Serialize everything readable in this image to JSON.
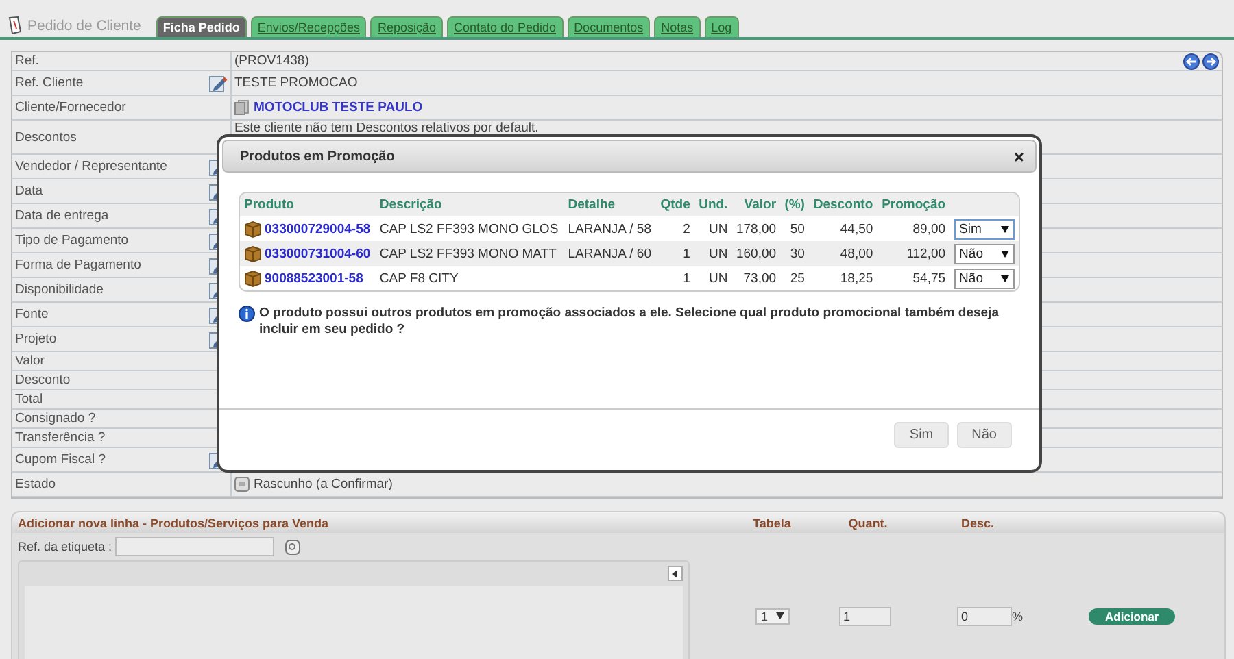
{
  "header": {
    "title": "Pedido de Cliente",
    "tabs": [
      {
        "label": "Ficha Pedido",
        "selected": true
      },
      {
        "label": "Envios/Recepções",
        "selected": false
      },
      {
        "label": "Reposição",
        "selected": false
      },
      {
        "label": "Contato do Pedido",
        "selected": false
      },
      {
        "label": "Documentos",
        "selected": false
      },
      {
        "label": "Notas",
        "selected": false
      },
      {
        "label": "Log",
        "selected": false
      }
    ]
  },
  "form": {
    "rows": [
      {
        "label": "Ref.",
        "kind": "text",
        "value": "(PROV1438)",
        "editable": false
      },
      {
        "label": "Ref. Cliente",
        "kind": "text",
        "value": "TESTE PROMOCAO",
        "editable": true
      },
      {
        "label": "Cliente/Fornecedor",
        "kind": "link",
        "value": "MOTOCLUB TESTE PAULO",
        "editable": false
      },
      {
        "label": "Descontos",
        "kind": "note",
        "value": "Este cliente não tem Descontos relativos por default.",
        "editable": false
      },
      {
        "label": "Vendedor / Representante",
        "kind": "text",
        "editable": true
      },
      {
        "label": "Data",
        "kind": "text",
        "editable": true
      },
      {
        "label": "Data de entrega",
        "kind": "text",
        "editable": true
      },
      {
        "label": "Tipo de Pagamento",
        "kind": "text",
        "editable": true
      },
      {
        "label": "Forma de Pagamento",
        "kind": "text",
        "editable": true
      },
      {
        "label": "Disponibilidade",
        "kind": "text",
        "editable": true
      },
      {
        "label": "Fonte",
        "kind": "text",
        "editable": true
      },
      {
        "label": "Projeto",
        "kind": "text",
        "editable": true
      },
      {
        "label": "Valor",
        "kind": "text",
        "editable": false
      },
      {
        "label": "Desconto",
        "kind": "text",
        "editable": false
      },
      {
        "label": "Total",
        "kind": "text",
        "editable": false
      },
      {
        "label": "Consignado ?",
        "kind": "text",
        "editable": false
      },
      {
        "label": "Transferência ?",
        "kind": "text",
        "editable": false
      },
      {
        "label": "Cupom Fiscal ?",
        "kind": "text",
        "editable": true
      },
      {
        "label": "Estado",
        "kind": "status",
        "value": "Rascunho (a Confirmar)",
        "editable": false
      }
    ]
  },
  "dialog": {
    "title": "Produtos em Promoção",
    "close": "×",
    "columns": [
      "Produto",
      "Descrição",
      "Detalhe",
      "Qtde",
      "Und.",
      "Valor",
      "(%)",
      "Desconto",
      "Promoção"
    ],
    "rows": [
      {
        "code": "033000729004-58",
        "description": "CAP LS2 FF393 MONO GLOS",
        "detail": "LARANJA / 58",
        "qty": "2",
        "unit": "UN",
        "price": "178,00",
        "percent": "50",
        "discount": "44,50",
        "promo": "89,00",
        "choice": "Sim",
        "focused": true
      },
      {
        "code": "033000731004-60",
        "description": "CAP LS2 FF393 MONO MATT",
        "detail": "LARANJA / 60",
        "qty": "1",
        "unit": "UN",
        "price": "160,00",
        "percent": "30",
        "discount": "48,00",
        "promo": "112,00",
        "choice": "Não",
        "focused": false
      },
      {
        "code": "90088523001-58",
        "description": "CAP F8 CITY",
        "qty": "1",
        "unit": "UN",
        "price": "73,00",
        "percent": "25",
        "discount": "18,25",
        "promo": "54,75",
        "choice": "Não",
        "focused": false
      }
    ],
    "message": "O produto possui outros produtos em promoção associados a ele. Selecione qual produto promocional também deseja incluir em seu pedido ?",
    "buttons": [
      "Sim",
      "Não"
    ]
  },
  "add_line": {
    "title": "Adicionar nova linha - Produtos/Serviços para Venda",
    "columns": [
      "Tabela",
      "Quant.",
      "Desc."
    ],
    "tag_label": "Ref. da etiqueta :",
    "table": "1",
    "quantity": "1",
    "discount": "0",
    "percent_sign": "%",
    "button": "Adicionar"
  }
}
